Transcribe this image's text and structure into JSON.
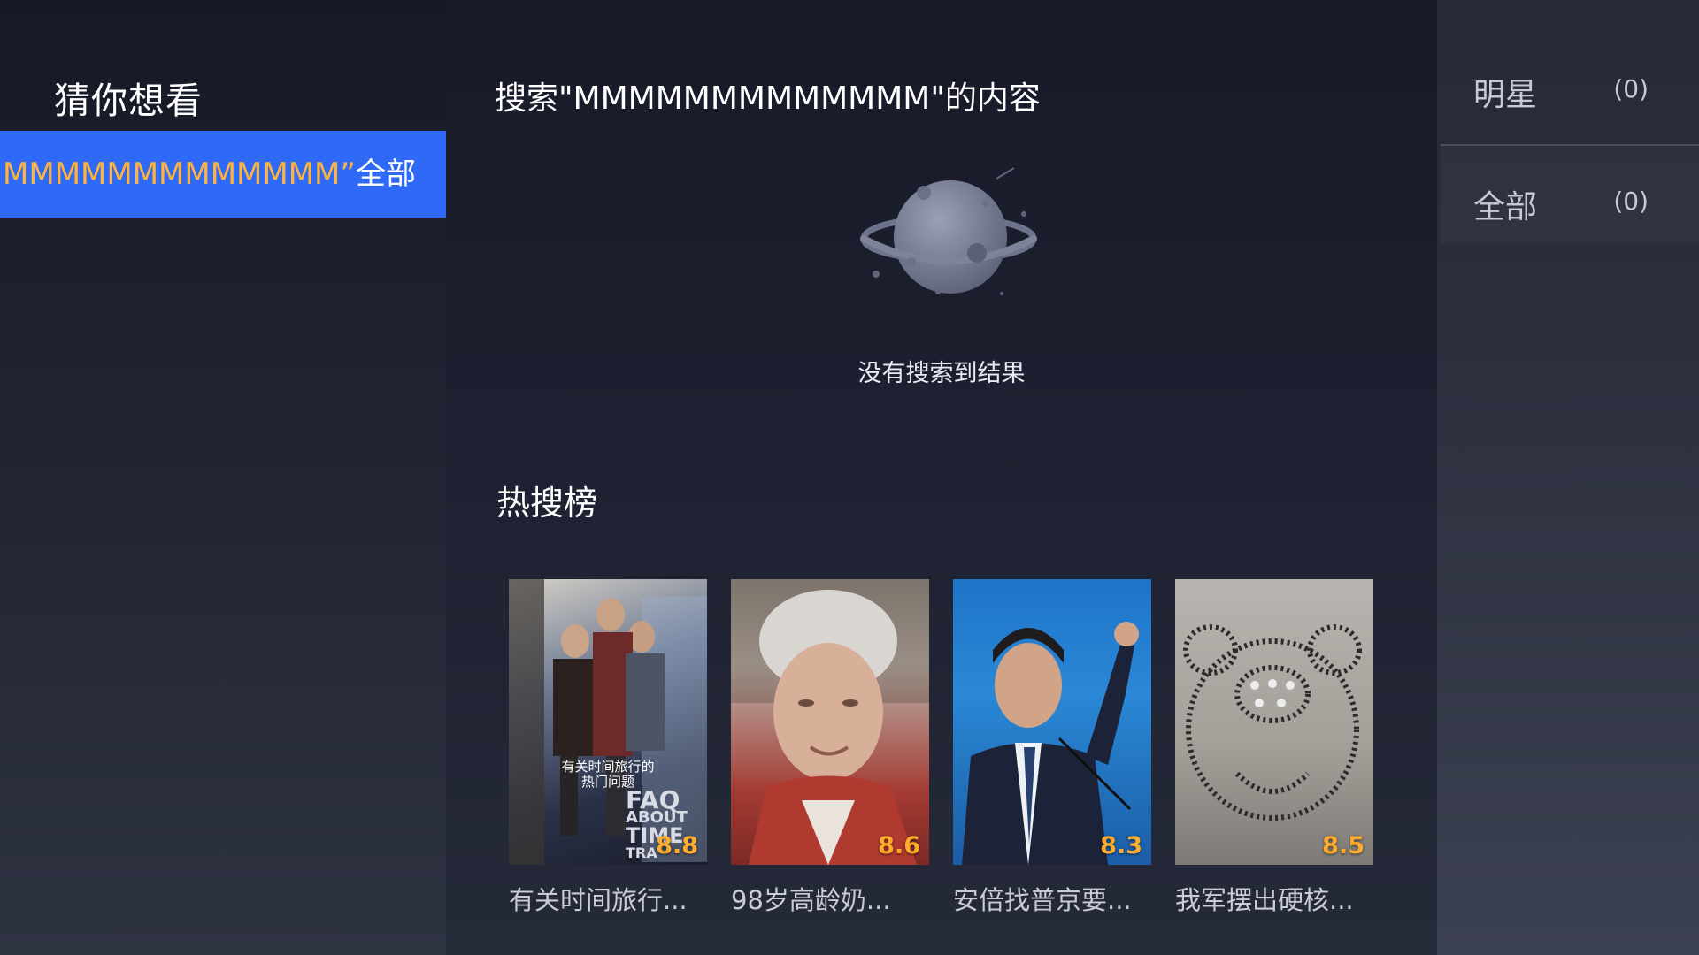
{
  "sidebar": {
    "title": "猜你想看",
    "active_item": {
      "query_part": "MMMMMMMMMMMMM”",
      "suffix": "全部"
    }
  },
  "main": {
    "search_heading": "搜索\"MMMMMMMMMMMMM\"的内容",
    "empty_message": "没有搜索到结果",
    "hot_title": "热搜榜",
    "hot_items": [
      {
        "title": "有关时间旅行...",
        "score": "8.8",
        "poster_caption_1": "有关时间旅行的",
        "poster_caption_2": "热门问题",
        "poster_logo_1": "FAQ",
        "poster_logo_2": "ABOUT",
        "poster_logo_3": "TIME",
        "poster_logo_4": "TRA"
      },
      {
        "title": "98岁高龄奶...",
        "score": "8.6"
      },
      {
        "title": "安倍找普京要...",
        "score": "8.3"
      },
      {
        "title": "我军摆出硬核...",
        "score": "8.5"
      }
    ]
  },
  "filters": [
    {
      "label": "明星",
      "count": "(0)"
    },
    {
      "label": "全部",
      "count": "(0)"
    }
  ],
  "colors": {
    "accent_blue": "#2f6af7",
    "query_orange": "#ffb33f",
    "score_orange": "#ffac2a"
  }
}
